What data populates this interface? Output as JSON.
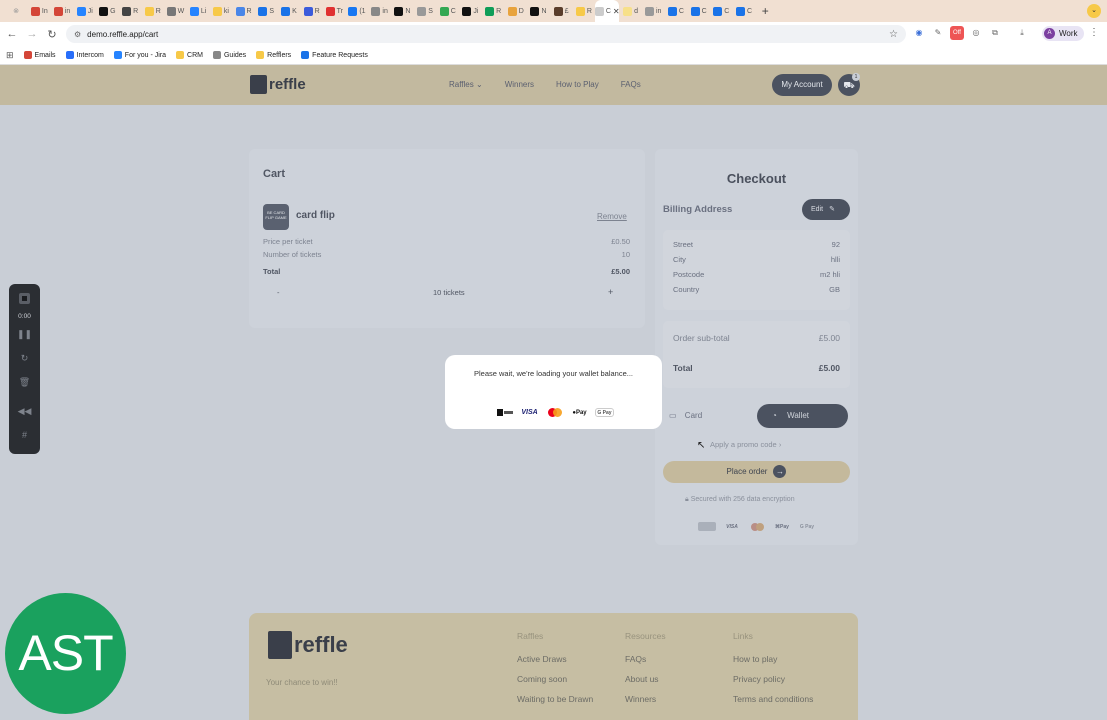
{
  "browser": {
    "tabs": [
      {
        "label": "In",
        "color": "#d44638"
      },
      {
        "label": "in",
        "color": "#d44638"
      },
      {
        "label": "Ji",
        "color": "#2684ff"
      },
      {
        "label": "G",
        "color": "#111111"
      },
      {
        "label": "R",
        "color": "#444444"
      },
      {
        "label": "R",
        "color": "#f7c948"
      },
      {
        "label": "W",
        "color": "#777777"
      },
      {
        "label": "Li",
        "color": "#2684ff"
      },
      {
        "label": "ki",
        "color": "#f7c948"
      },
      {
        "label": "R",
        "color": "#4a86e8"
      },
      {
        "label": "S",
        "color": "#1a73e8"
      },
      {
        "label": "K",
        "color": "#1a73e8"
      },
      {
        "label": "R",
        "color": "#3b5bdb"
      },
      {
        "label": "Tr",
        "color": "#e03131"
      },
      {
        "label": "(1",
        "color": "#1877f2"
      },
      {
        "label": "in",
        "color": "#888888"
      },
      {
        "label": "N",
        "color": "#111111"
      },
      {
        "label": "S",
        "color": "#999999"
      },
      {
        "label": "C",
        "color": "#34a853"
      },
      {
        "label": "Ji",
        "color": "#111111"
      },
      {
        "label": "R",
        "color": "#0f9d58"
      },
      {
        "label": "D",
        "color": "#e8a33d"
      },
      {
        "label": "N",
        "color": "#111111"
      },
      {
        "label": "£",
        "color": "#5a3d2b"
      },
      {
        "label": "R",
        "color": "#f7c948"
      },
      {
        "label": "C",
        "active": true,
        "color": "#cccccc"
      },
      {
        "label": "d",
        "color": "#f7e08a"
      },
      {
        "label": "in",
        "color": "#999999"
      },
      {
        "label": "C",
        "color": "#1a73e8"
      },
      {
        "label": "C",
        "color": "#1a73e8"
      },
      {
        "label": "C",
        "color": "#1a73e8"
      },
      {
        "label": "C",
        "color": "#1a73e8"
      }
    ],
    "active_tab_close": "✕",
    "new_tab": "+",
    "url": "demo.reffle.app/cart",
    "profile_label": "Work",
    "profile_initial": "A",
    "extension_badge": "Off",
    "bookmarks": [
      {
        "label": "Emails",
        "color": "#d44638"
      },
      {
        "label": "Intercom",
        "color": "#286efa"
      },
      {
        "label": "For you - Jira",
        "color": "#2684ff"
      },
      {
        "label": "CRM",
        "color": "#f7c948"
      },
      {
        "label": "Guides",
        "color": "#888888"
      },
      {
        "label": "Refflers",
        "color": "#f7c948"
      },
      {
        "label": "Feature Requests",
        "color": "#1a73e8"
      }
    ]
  },
  "site": {
    "brand": "reffle",
    "nav": [
      "Raffles",
      "Winners",
      "How to Play",
      "FAQs"
    ],
    "account_button": "My Account",
    "cart_count": "1"
  },
  "cart": {
    "title": "Cart",
    "thumb_text": "BE CARD FLIP GAME",
    "product": "card flip",
    "remove": "Remove",
    "price_label": "Price per ticket",
    "price_value": "£0.50",
    "tickets_label": "Number of tickets",
    "tickets_value": "10",
    "total_label": "Total",
    "total_value": "£5.00",
    "qty_minus": "-",
    "qty_text": "10 tickets",
    "qty_plus": "+"
  },
  "checkout": {
    "title": "Checkout",
    "billing_label": "Billing Address",
    "edit_label": "Edit",
    "address": [
      {
        "label": "Street",
        "value": "92"
      },
      {
        "label": "City",
        "value": "hlli"
      },
      {
        "label": "Postcode",
        "value": "m2 hli"
      },
      {
        "label": "Country",
        "value": "GB"
      }
    ],
    "subtotal_label": "Order sub-total",
    "subtotal_value": "£5.00",
    "total_label": "Total",
    "total_value": "£5.00",
    "pay_card": "Card",
    "pay_wallet": "Wallet",
    "promo": "Apply a promo code",
    "place_order": "Place order",
    "secure_note": "Secured with 256 data encryption",
    "payment_logos": [
      "VISA",
      "Pay",
      "G Pay"
    ]
  },
  "modal": {
    "message": "Please wait, we're loading your wallet balance...",
    "logos": {
      "visa": "VISA",
      "apple": "Pay",
      "gpay": "G Pay"
    }
  },
  "footer": {
    "brand": "reffle",
    "tagline": "Your chance to win!!",
    "columns": [
      {
        "heading": "Raffles",
        "links": [
          "Active Draws",
          "Coming soon",
          "Waiting to be Drawn"
        ]
      },
      {
        "heading": "Resources",
        "links": [
          "FAQs",
          "About us",
          "Winners"
        ]
      },
      {
        "heading": "Links",
        "links": [
          "How to play",
          "Privacy policy",
          "Terms and conditions"
        ]
      }
    ]
  },
  "recorder": {
    "time": "0:00"
  },
  "watermark": "AST"
}
